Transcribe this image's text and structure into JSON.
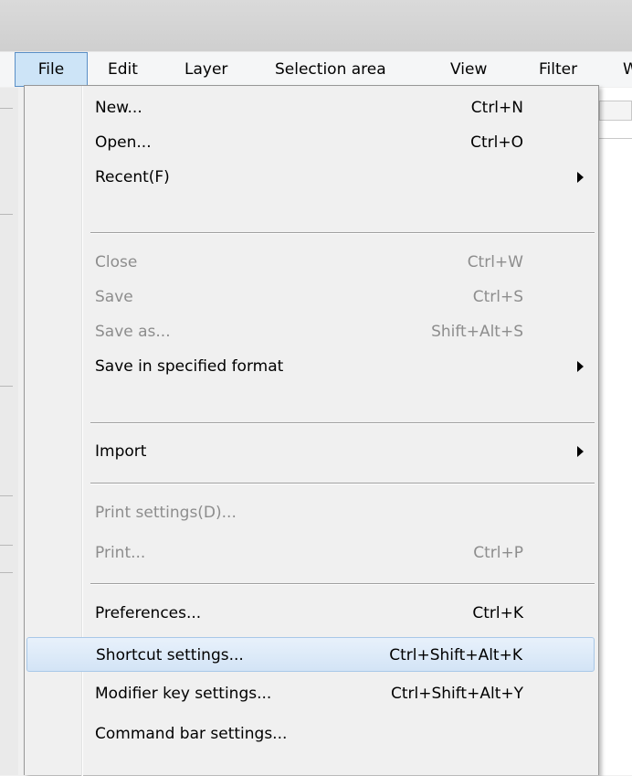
{
  "menubar": {
    "items": [
      {
        "label": "File",
        "active": true
      },
      {
        "label": "Edit"
      },
      {
        "label": "Layer"
      },
      {
        "label": "Selection area"
      },
      {
        "label": "View"
      },
      {
        "label": "Filter"
      },
      {
        "label": "W"
      }
    ]
  },
  "file_menu": {
    "items": [
      {
        "label": "New...",
        "shortcut": "Ctrl+N",
        "enabled": true
      },
      {
        "label": "Open...",
        "shortcut": "Ctrl+O",
        "enabled": true
      },
      {
        "label": "Recent(F)",
        "shortcut": "",
        "enabled": true,
        "submenu": true
      },
      {
        "label": "Close",
        "shortcut": "Ctrl+W",
        "enabled": false
      },
      {
        "label": "Save",
        "shortcut": "Ctrl+S",
        "enabled": false
      },
      {
        "label": "Save as...",
        "shortcut": "Shift+Alt+S",
        "enabled": false
      },
      {
        "label": "Save in specified format",
        "shortcut": "",
        "enabled": true,
        "submenu": true
      },
      {
        "label": "Import",
        "shortcut": "",
        "enabled": true,
        "submenu": true
      },
      {
        "label": "Print settings(D)...",
        "shortcut": "",
        "enabled": false
      },
      {
        "label": "Print...",
        "shortcut": "Ctrl+P",
        "enabled": false
      },
      {
        "label": "Preferences...",
        "shortcut": "Ctrl+K",
        "enabled": true
      },
      {
        "label": "Shortcut settings...",
        "shortcut": "Ctrl+Shift+Alt+K",
        "enabled": true,
        "highlighted": true
      },
      {
        "label": "Modifier key settings...",
        "shortcut": "Ctrl+Shift+Alt+Y",
        "enabled": true
      },
      {
        "label": "Command bar settings...",
        "shortcut": "",
        "enabled": true
      }
    ]
  },
  "colors": {
    "highlight_bg": "#d3e4f6",
    "active_menu_border": "#5a8fc6",
    "disabled_text": "#8d8d8d"
  }
}
